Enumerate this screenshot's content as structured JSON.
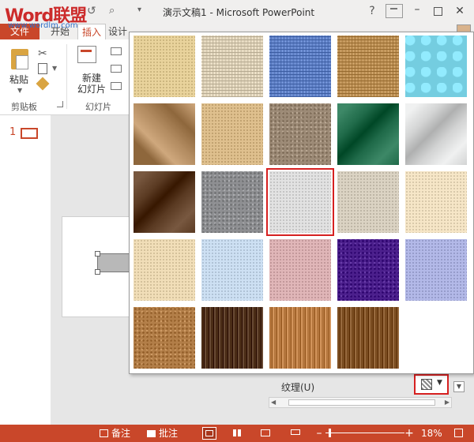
{
  "window": {
    "title": "演示文稿1 - Microsoft PowerPoint",
    "help": "?",
    "minimize": "–",
    "close": "✕"
  },
  "watermark": {
    "logo": "Word联盟",
    "url": "www.wordlm.com"
  },
  "tabs": {
    "file": "文件",
    "start": "开始",
    "insert": "插入",
    "design": "设计"
  },
  "ribbon": {
    "paste": "粘贴",
    "clipboard_group": "剪贴板",
    "new_slide_line1": "新建",
    "new_slide_line2": "幻灯片",
    "slides_group": "幻灯片"
  },
  "slide_pane": {
    "slide_number": "1"
  },
  "format_pane": {
    "texture_label": "纹理(U)"
  },
  "texture_gallery": {
    "rows": 5,
    "columns": 5,
    "selected_index": 12,
    "textures": [
      {
        "name": "papyrus",
        "color": "#e9d39c",
        "pattern": "fine"
      },
      {
        "name": "canvas",
        "color": "#d9cdb4",
        "pattern": "weave"
      },
      {
        "name": "denim",
        "color": "#5e7fc4",
        "pattern": "weave"
      },
      {
        "name": "woven-mat",
        "color": "#b98d52",
        "pattern": "weave"
      },
      {
        "name": "water-droplets",
        "color": "#74cde0",
        "pattern": "drops"
      },
      {
        "name": "paper-bag",
        "color": "#b18a5f",
        "pattern": "crumpled"
      },
      {
        "name": "fish-fossil",
        "color": "#dfc08e",
        "pattern": "fine"
      },
      {
        "name": "sand",
        "color": "#9c8a76",
        "pattern": "speckle"
      },
      {
        "name": "green-marble",
        "color": "#1f6a49",
        "pattern": "marble"
      },
      {
        "name": "white-marble",
        "color": "#d2d3d3",
        "pattern": "marble"
      },
      {
        "name": "brown-marble",
        "color": "#5a3a22",
        "pattern": "marble"
      },
      {
        "name": "granite",
        "color": "#8e8f92",
        "pattern": "speckle"
      },
      {
        "name": "newsprint",
        "color": "#e2e2e2",
        "pattern": "fine"
      },
      {
        "name": "recycled-paper",
        "color": "#dbd3c3",
        "pattern": "fine"
      },
      {
        "name": "parchment",
        "color": "#f6e6c7",
        "pattern": "fine"
      },
      {
        "name": "stationery",
        "color": "#f1deb8",
        "pattern": "fine"
      },
      {
        "name": "blue-tissue-paper",
        "color": "#cde0f3",
        "pattern": "fine"
      },
      {
        "name": "pink-tissue-paper",
        "color": "#e0b6b8",
        "pattern": "fine"
      },
      {
        "name": "purple-mesh",
        "color": "#4b1f8c",
        "pattern": "speckle"
      },
      {
        "name": "bouquet",
        "color": "#b3b9e8",
        "pattern": "fine"
      },
      {
        "name": "cork",
        "color": "#b27e48",
        "pattern": "speckle"
      },
      {
        "name": "walnut",
        "color": "#4a2c16",
        "pattern": "wood"
      },
      {
        "name": "oak",
        "color": "#b5773e",
        "pattern": "wood"
      },
      {
        "name": "medium-wood",
        "color": "#7a4c20",
        "pattern": "wood"
      }
    ]
  },
  "statusbar": {
    "notes": "备注",
    "comments": "批注",
    "zoom_out": "–",
    "zoom_in": "+",
    "zoom_level": "18%",
    "zoom_fraction": 0.04
  }
}
